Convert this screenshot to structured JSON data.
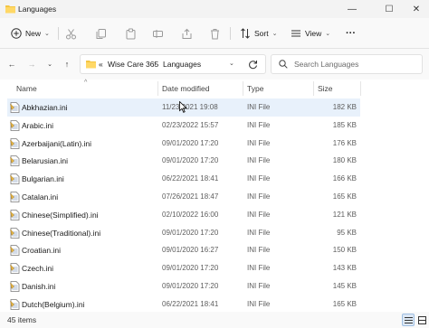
{
  "window": {
    "title": "Languages",
    "minimize_glyph": "—",
    "maximize_glyph": "☐",
    "close_glyph": "✕"
  },
  "toolbar": {
    "new_label": "New",
    "sort_label": "Sort",
    "view_label": "View",
    "more_label": "···",
    "icons": [
      "cut-icon",
      "copy-icon",
      "paste-icon",
      "rename-icon",
      "share-icon",
      "delete-icon"
    ]
  },
  "address": {
    "overflow": "«",
    "crumbs": [
      "Wise Care 365",
      "Languages"
    ],
    "separator": "›"
  },
  "search": {
    "placeholder": "Search Languages"
  },
  "columns": {
    "name": "Name",
    "date": "Date modified",
    "type": "Type",
    "size": "Size"
  },
  "files": [
    {
      "name": "Abkhazian.ini",
      "date": "11/23/2021 19:08",
      "type": "INI File",
      "size": "182 KB",
      "hover": true
    },
    {
      "name": "Arabic.ini",
      "date": "02/23/2022 15:57",
      "type": "INI File",
      "size": "185 KB"
    },
    {
      "name": "Azerbaijani(Latin).ini",
      "date": "09/01/2020 17:20",
      "type": "INI File",
      "size": "176 KB"
    },
    {
      "name": "Belarusian.ini",
      "date": "09/01/2020 17:20",
      "type": "INI File",
      "size": "180 KB"
    },
    {
      "name": "Bulgarian.ini",
      "date": "06/22/2021 18:41",
      "type": "INI File",
      "size": "166 KB"
    },
    {
      "name": "Catalan.ini",
      "date": "07/26/2021 18:47",
      "type": "INI File",
      "size": "165 KB"
    },
    {
      "name": "Chinese(Simplified).ini",
      "date": "02/10/2022 16:00",
      "type": "INI File",
      "size": "121 KB"
    },
    {
      "name": "Chinese(Traditional).ini",
      "date": "09/01/2020 17:20",
      "type": "INI File",
      "size": "95 KB"
    },
    {
      "name": "Croatian.ini",
      "date": "09/01/2020 16:27",
      "type": "INI File",
      "size": "150 KB"
    },
    {
      "name": "Czech.ini",
      "date": "09/01/2020 17:20",
      "type": "INI File",
      "size": "143 KB"
    },
    {
      "name": "Danish.ini",
      "date": "09/01/2020 17:20",
      "type": "INI File",
      "size": "145 KB"
    },
    {
      "name": "Dutch(Belgium).ini",
      "date": "06/22/2021 18:41",
      "type": "INI File",
      "size": "165 KB"
    }
  ],
  "status": {
    "count": "45 items"
  }
}
